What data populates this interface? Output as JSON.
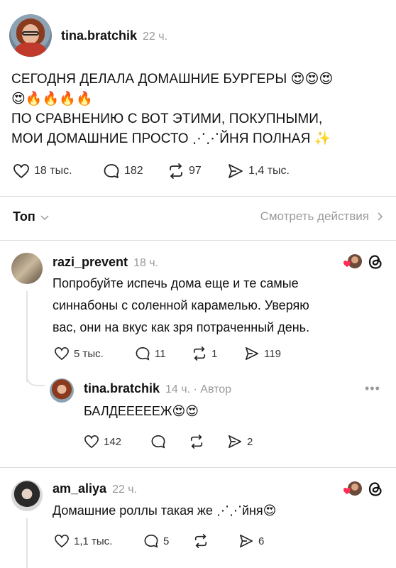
{
  "post": {
    "username": "tina.bratchik",
    "time": "22 ч.",
    "lines": [
      "СЕГОДНЯ ДЕЛАЛА ДОМАШНИЕ БУРГЕРЫ 😍😍😍",
      "😍🔥🔥🔥🔥",
      "ПО СРАВНЕНИЮ С ВОТ ЭТИМИ, ПОКУПНЫМИ,",
      "МОИ ДОМАШНИЕ ПРОСТО ⋰⋰ЙНЯ ПОЛНАЯ ✨"
    ],
    "likes": "18 тыс.",
    "comments": "182",
    "reposts": "97",
    "shares": "1,4 тыс."
  },
  "sort": {
    "label": "Топ",
    "activity": "Смотреть действия"
  },
  "comments": [
    {
      "username": "razi_prevent",
      "time": "18 ч.",
      "lines": [
        "Попробуйте испечь дома еще и те самые",
        "синнабоны с соленной карамелью. Уверяю",
        "вас, они на вкус как зря потраченный день."
      ],
      "likes": "5 тыс.",
      "comments": "11",
      "reposts": "1",
      "shares": "119",
      "reply": {
        "username": "tina.bratchik",
        "meta": "14 ч. · Автор",
        "text": "БАЛДЕЕЕЕЕЖ😍😍",
        "likes": "142",
        "shares": "2"
      }
    },
    {
      "username": "am_aliya",
      "time": "22 ч.",
      "text": "Домашние роллы такая же ⋰⋰йня😍",
      "likes": "1,1 тыс.",
      "comments": "5",
      "shares": "6"
    }
  ]
}
